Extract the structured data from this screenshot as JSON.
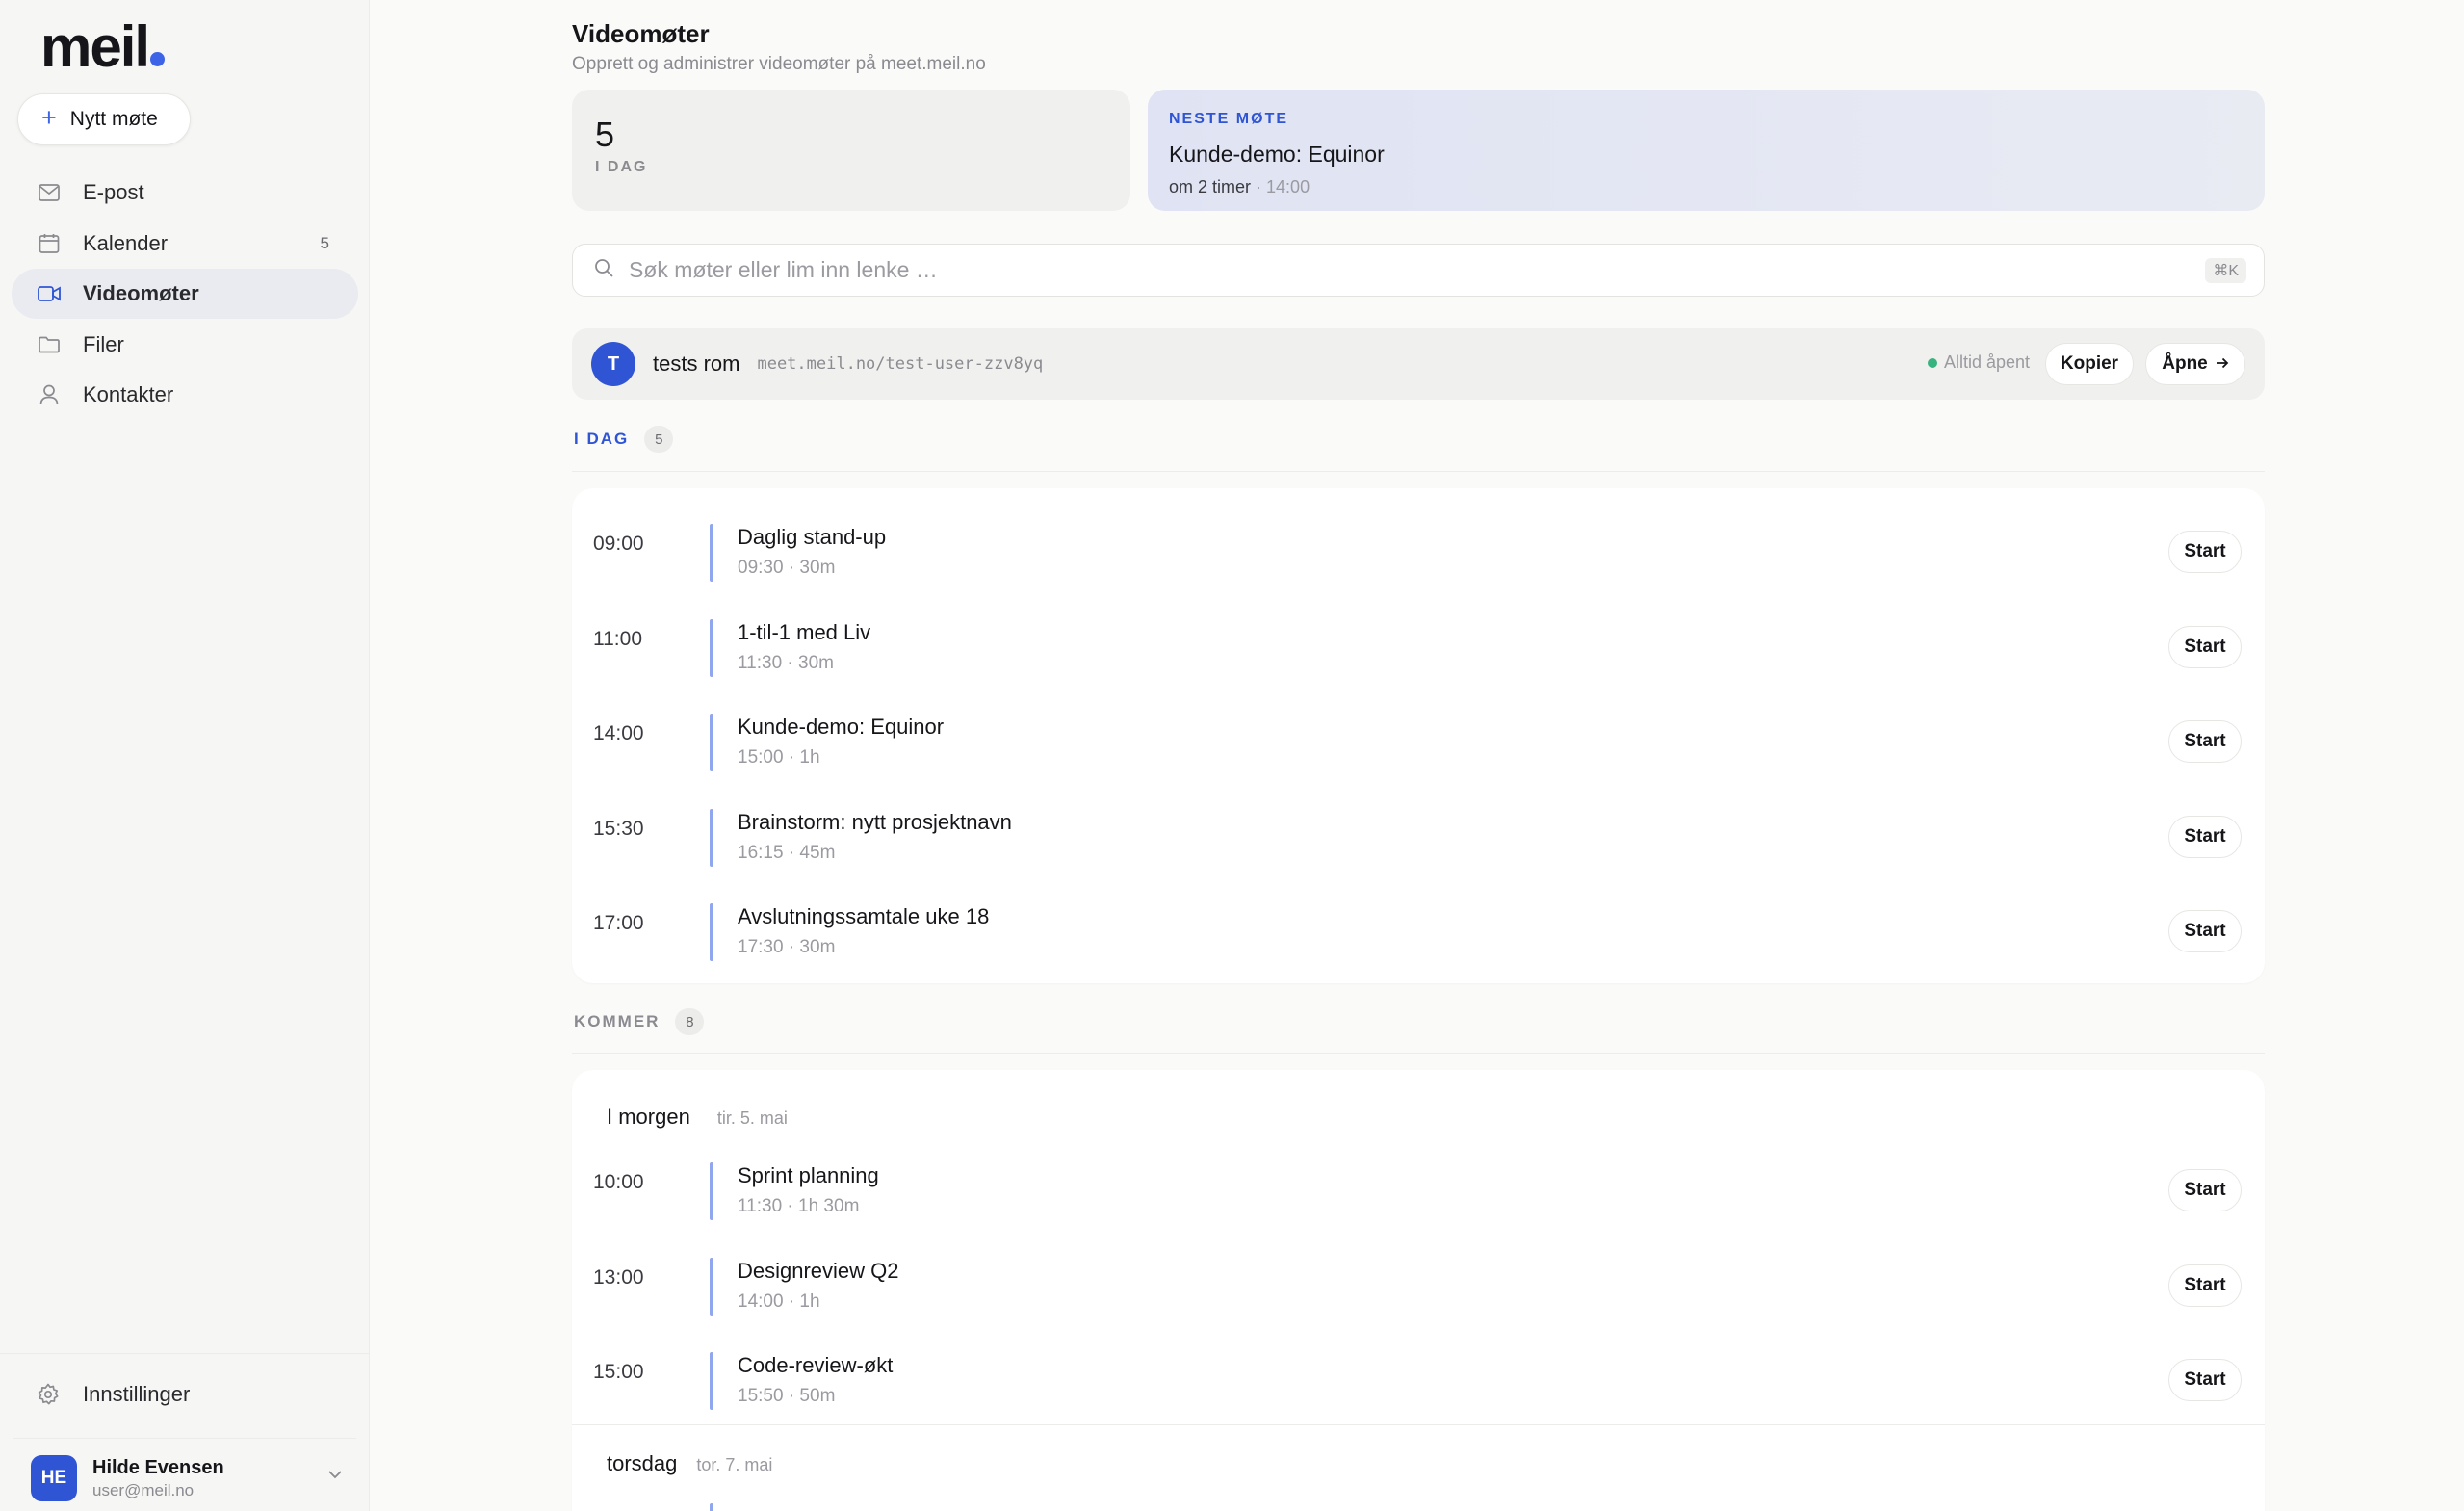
{
  "sidebar": {
    "logo": "meil",
    "new_button": "Nytt møte",
    "items": [
      {
        "label": "E-post",
        "icon": "mail-icon",
        "badge": ""
      },
      {
        "label": "Kalender",
        "icon": "calendar-icon",
        "badge": "5"
      },
      {
        "label": "Videomøter",
        "icon": "video-icon",
        "badge": "",
        "active": true
      },
      {
        "label": "Filer",
        "icon": "folder-icon",
        "badge": ""
      },
      {
        "label": "Kontakter",
        "icon": "user-icon",
        "badge": ""
      }
    ],
    "settings": "Innstillinger",
    "user": {
      "initials": "HE",
      "name": "Hilde Evensen",
      "email": "user@meil.no"
    }
  },
  "header": {
    "title": "Videomøter",
    "subtitle": "Opprett og administrer videomøter på meet.meil.no"
  },
  "stats": {
    "today_count": "5",
    "today_label": "I DAG"
  },
  "next_meeting": {
    "label": "NESTE MØTE",
    "title": "Kunde-demo: Equinor",
    "relative": "om 2 timer",
    "separator": " · ",
    "time": "14:00"
  },
  "search": {
    "placeholder": "Søk møter eller lim inn lenke …",
    "shortcut": "⌘K"
  },
  "room": {
    "initial": "T",
    "name": "tests rom",
    "url": "meet.meil.no/test-user-zzv8yq",
    "status": "Alltid åpent",
    "copy_label": "Kopier",
    "open_label": "Åpne"
  },
  "today": {
    "label": "I DAG",
    "count": "5",
    "meetings": [
      {
        "time": "09:00",
        "title": "Daglig stand-up",
        "meta": "09:30 · 30m",
        "action": "Start"
      },
      {
        "time": "11:00",
        "title": "1-til-1 med Liv",
        "meta": "11:30 · 30m",
        "action": "Start"
      },
      {
        "time": "14:00",
        "title": "Kunde-demo: Equinor",
        "meta": "15:00 · 1h",
        "action": "Start"
      },
      {
        "time": "15:30",
        "title": "Brainstorm: nytt prosjektnavn",
        "meta": "16:15 · 45m",
        "action": "Start"
      },
      {
        "time": "17:00",
        "title": "Avslutningssamtale uke 18",
        "meta": "17:30 · 30m",
        "action": "Start"
      }
    ]
  },
  "upcoming": {
    "label": "KOMMER",
    "count": "8",
    "days": [
      {
        "name": "I morgen",
        "date": "tir. 5. mai",
        "meetings": [
          {
            "time": "10:00",
            "title": "Sprint planning",
            "meta": "11:30 · 1h 30m",
            "action": "Start"
          },
          {
            "time": "13:00",
            "title": "Designreview Q2",
            "meta": "14:00 · 1h",
            "action": "Start"
          },
          {
            "time": "15:00",
            "title": "Code-review-økt",
            "meta": "15:50 · 50m",
            "action": "Start"
          }
        ]
      },
      {
        "name": "torsdag",
        "date": "tor. 7. mai",
        "meetings": []
      }
    ]
  },
  "colors": {
    "accent": "#2f55d4",
    "accent_light": "#90a6ee",
    "status_green": "#36b37e",
    "background": "#fafaf9"
  }
}
